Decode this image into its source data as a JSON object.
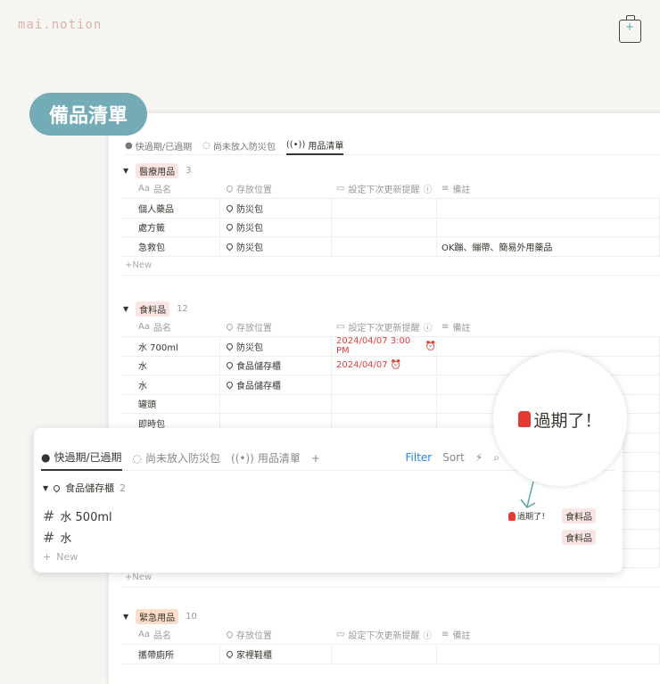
{
  "logo": "mai.notion",
  "title": "備品清單",
  "tabs": [
    "快過期/已過期",
    "尚未放入防災包",
    "用品清單"
  ],
  "columns": {
    "name": "品名",
    "location": "存放位置",
    "reminder": "設定下次更新提醒",
    "notes": "備註",
    "name_prefix": "Aa"
  },
  "new_label": "New",
  "groups": [
    {
      "name": "醫療用品",
      "count": "3",
      "color": "#fbe4e4",
      "rows": [
        {
          "name": "個人藥品",
          "location": "防災包",
          "reminder": "",
          "notes": ""
        },
        {
          "name": "處方籤",
          "location": "防災包",
          "reminder": "",
          "notes": ""
        },
        {
          "name": "急救包",
          "location": "防災包",
          "reminder": "",
          "notes": "OK蹦、繃帶、簡易外用藥品"
        }
      ]
    },
    {
      "name": "食料品",
      "count": "12",
      "color": "#fbe4e4",
      "rows": [
        {
          "name": "水 700ml",
          "location": "防災包",
          "reminder": "2024/04/07 3:00 PM",
          "notes": ""
        },
        {
          "name": "水",
          "location": "食品儲存櫃",
          "reminder": "2024/04/07",
          "notes": ""
        },
        {
          "name": "水",
          "location": "食品儲存櫃",
          "reminder": "",
          "notes": ""
        },
        {
          "name": "罐頭",
          "location": "",
          "reminder": "",
          "notes": ""
        },
        {
          "name": "即時包",
          "location": "",
          "reminder": "",
          "notes": ""
        }
      ]
    },
    {
      "name": "緊急用品",
      "count": "10",
      "color": "#fadec9",
      "rows": [
        {
          "name": "攜帶廁所",
          "location": "家裡鞋櫃",
          "reminder": "",
          "notes": ""
        }
      ]
    }
  ],
  "popup": {
    "tools": {
      "filter": "Filter",
      "sort": "Sort"
    },
    "group": {
      "name": "食品儲存櫃",
      "count": "2"
    },
    "rows": [
      {
        "name": "水 500ml",
        "status": "過期了！",
        "tag": "食料品"
      },
      {
        "name": "水",
        "status": "",
        "tag": "食料品"
      }
    ]
  },
  "callout": "過期了！"
}
